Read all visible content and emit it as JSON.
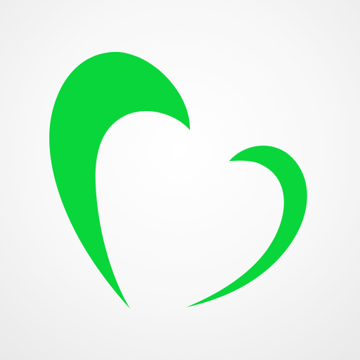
{
  "app_icon": {
    "icon_name": "green-heart-logo-icon",
    "colors": {
      "mark": "#09d63a",
      "background": "#f3f3f3"
    }
  }
}
